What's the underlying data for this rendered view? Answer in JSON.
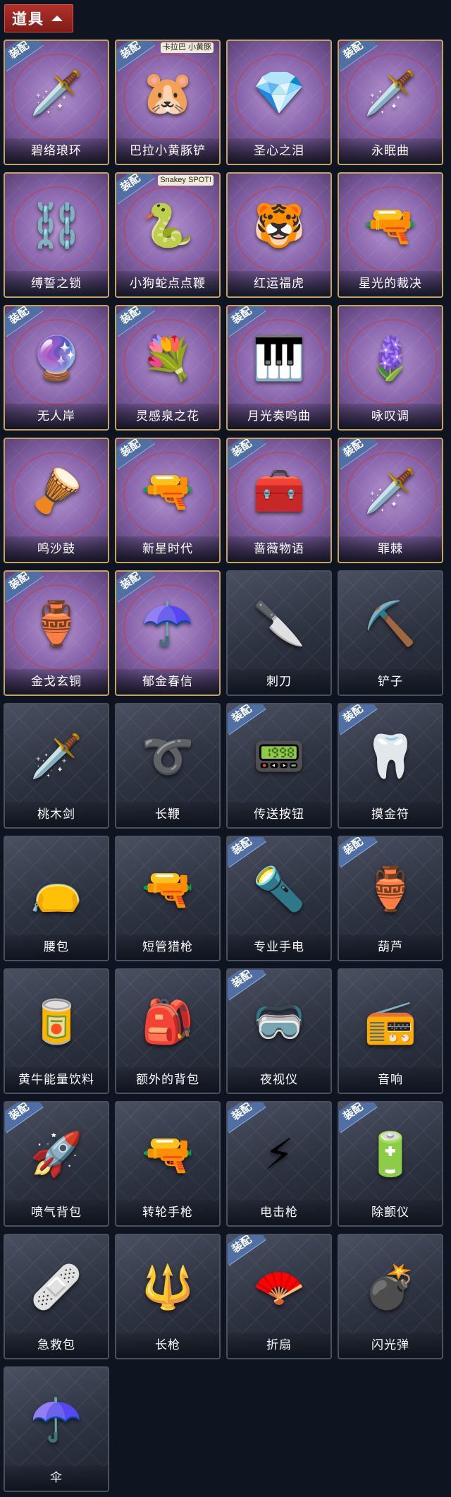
{
  "header": {
    "label": "道具"
  },
  "items": [
    {
      "name": "碧络琅环",
      "equipped": true,
      "rare": true,
      "icon": "🗡️"
    },
    {
      "name": "巴拉小黄豚铲",
      "equipped": true,
      "rare": true,
      "icon": "🐹",
      "sticker": "卡拉巴 小黄豚"
    },
    {
      "name": "圣心之泪",
      "equipped": false,
      "rare": true,
      "icon": "💎"
    },
    {
      "name": "永眠曲",
      "equipped": true,
      "rare": true,
      "icon": "🗡️"
    },
    {
      "name": "缚誓之锁",
      "equipped": false,
      "rare": true,
      "icon": "⛓️"
    },
    {
      "name": "小狗蛇点点鞭",
      "equipped": true,
      "rare": true,
      "icon": "🐍",
      "sticker": "Snakey SPOT!"
    },
    {
      "name": "红运福虎",
      "equipped": false,
      "rare": true,
      "icon": "🐯"
    },
    {
      "name": "星光的裁决",
      "equipped": false,
      "rare": true,
      "icon": "🔫"
    },
    {
      "name": "无人岸",
      "equipped": true,
      "rare": true,
      "icon": "🔮"
    },
    {
      "name": "灵感泉之花",
      "equipped": true,
      "rare": true,
      "icon": "💐"
    },
    {
      "name": "月光奏鸣曲",
      "equipped": true,
      "rare": true,
      "icon": "🎹"
    },
    {
      "name": "咏叹调",
      "equipped": false,
      "rare": true,
      "icon": "🪻"
    },
    {
      "name": "鸣沙鼓",
      "equipped": false,
      "rare": true,
      "icon": "🪘"
    },
    {
      "name": "新星时代",
      "equipped": true,
      "rare": true,
      "icon": "🔫"
    },
    {
      "name": "蔷薇物语",
      "equipped": true,
      "rare": true,
      "icon": "🧰"
    },
    {
      "name": "罪棘",
      "equipped": true,
      "rare": true,
      "icon": "🗡️"
    },
    {
      "name": "金戈玄铜",
      "equipped": true,
      "rare": true,
      "icon": "🏺"
    },
    {
      "name": "郁金春信",
      "equipped": true,
      "rare": true,
      "icon": "☂️"
    },
    {
      "name": "刺刀",
      "equipped": false,
      "rare": false,
      "icon": "🔪"
    },
    {
      "name": "铲子",
      "equipped": false,
      "rare": false,
      "icon": "⛏️"
    },
    {
      "name": "桃木剑",
      "equipped": false,
      "rare": false,
      "icon": "🗡️"
    },
    {
      "name": "长鞭",
      "equipped": false,
      "rare": false,
      "icon": "➰"
    },
    {
      "name": "传送按钮",
      "equipped": true,
      "rare": false,
      "icon": "📟"
    },
    {
      "name": "摸金符",
      "equipped": true,
      "rare": false,
      "icon": "🦷"
    },
    {
      "name": "腰包",
      "equipped": false,
      "rare": false,
      "icon": "👝"
    },
    {
      "name": "短管猎枪",
      "equipped": false,
      "rare": false,
      "icon": "🔫"
    },
    {
      "name": "专业手电",
      "equipped": true,
      "rare": false,
      "icon": "🔦"
    },
    {
      "name": "葫芦",
      "equipped": true,
      "rare": false,
      "icon": "🏺"
    },
    {
      "name": "黄牛能量饮料",
      "equipped": false,
      "rare": false,
      "icon": "🥫"
    },
    {
      "name": "额外的背包",
      "equipped": false,
      "rare": false,
      "icon": "🎒"
    },
    {
      "name": "夜视仪",
      "equipped": true,
      "rare": false,
      "icon": "🥽"
    },
    {
      "name": "音响",
      "equipped": false,
      "rare": false,
      "icon": "📻"
    },
    {
      "name": "喷气背包",
      "equipped": true,
      "rare": false,
      "icon": "🚀"
    },
    {
      "name": "转轮手枪",
      "equipped": false,
      "rare": false,
      "icon": "🔫"
    },
    {
      "name": "电击枪",
      "equipped": true,
      "rare": false,
      "icon": "⚡"
    },
    {
      "name": "除颤仪",
      "equipped": true,
      "rare": false,
      "icon": "🔋"
    },
    {
      "name": "急救包",
      "equipped": false,
      "rare": false,
      "icon": "🩹"
    },
    {
      "name": "长枪",
      "equipped": false,
      "rare": false,
      "icon": "🔱"
    },
    {
      "name": "折扇",
      "equipped": true,
      "rare": false,
      "icon": "🪭"
    },
    {
      "name": "闪光弹",
      "equipped": false,
      "rare": false,
      "icon": "💣"
    },
    {
      "name": "伞",
      "equipped": false,
      "rare": false,
      "icon": "☂️"
    }
  ],
  "equipped_badge_label": "装配"
}
